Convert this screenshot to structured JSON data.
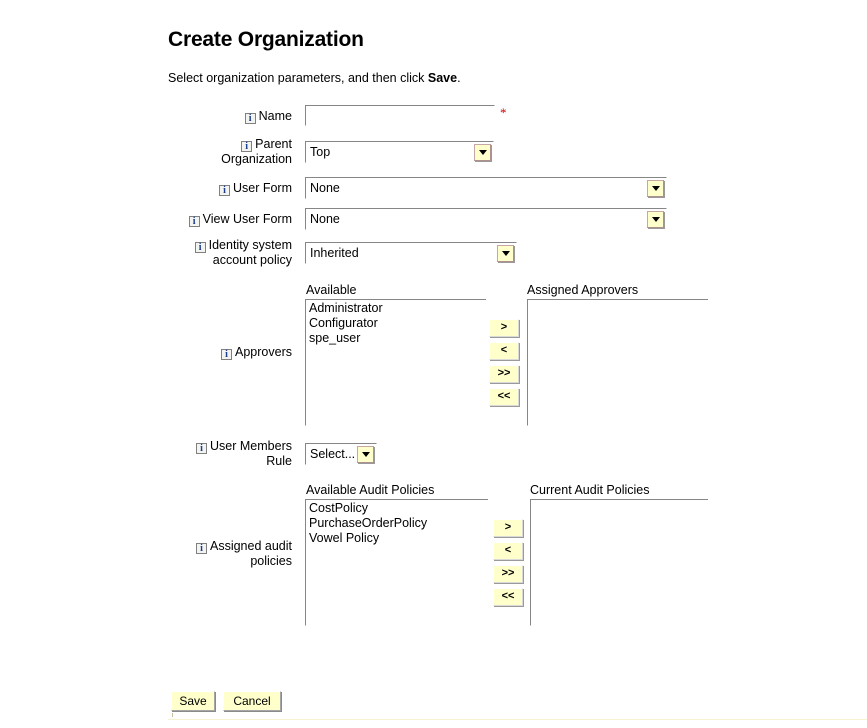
{
  "page": {
    "title": "Create Organization",
    "subtitle_before": "Select organization parameters, and then click ",
    "subtitle_bold": "Save",
    "subtitle_after": "."
  },
  "icons": {
    "info": "i",
    "required_marker": "*",
    "dropdown": "chevron-down-icon"
  },
  "fields": {
    "name": {
      "label": "Name",
      "value": "",
      "placeholder": "",
      "required": true
    },
    "parent_organization": {
      "label_line1": "Parent",
      "label_line2": "Organization",
      "value": "Top",
      "options": [
        "Top"
      ]
    },
    "user_form": {
      "label": "User Form",
      "value": "None",
      "options": [
        "None"
      ]
    },
    "view_user_form": {
      "label": "View User Form",
      "value": "None",
      "options": [
        "None"
      ]
    },
    "identity_system_account_policy": {
      "label_line1": "Identity system",
      "label_line2": "account policy",
      "value": "Inherited",
      "options": [
        "Inherited"
      ]
    },
    "user_members_rule": {
      "label_line1": "User Members",
      "label_line2": "Rule",
      "value": "Select...",
      "options": [
        "Select..."
      ]
    }
  },
  "approvers": {
    "label": "Approvers",
    "available_header": "Available",
    "available_items": [
      "Administrator",
      "Configurator",
      "spe_user"
    ],
    "assigned_header": "Assigned Approvers",
    "assigned_items": [],
    "buttons": [
      ">",
      "<",
      ">>",
      "<<"
    ]
  },
  "audit_policies": {
    "label_line1": "Assigned audit",
    "label_line2": "policies",
    "available_header": "Available Audit Policies",
    "available_items": [
      "CostPolicy",
      "PurchaseOrderPolicy",
      "Vowel Policy"
    ],
    "assigned_header": "Current Audit Policies",
    "assigned_items": [],
    "buttons": [
      ">",
      "<",
      ">>",
      "<<"
    ]
  },
  "footer": {
    "save_label": "Save",
    "cancel_label": "Cancel"
  },
  "colors": {
    "button_face": "#ffffcc",
    "required_star": "#cc0000",
    "info_glyph": "#1a3d8f",
    "field_border": "#868686"
  }
}
